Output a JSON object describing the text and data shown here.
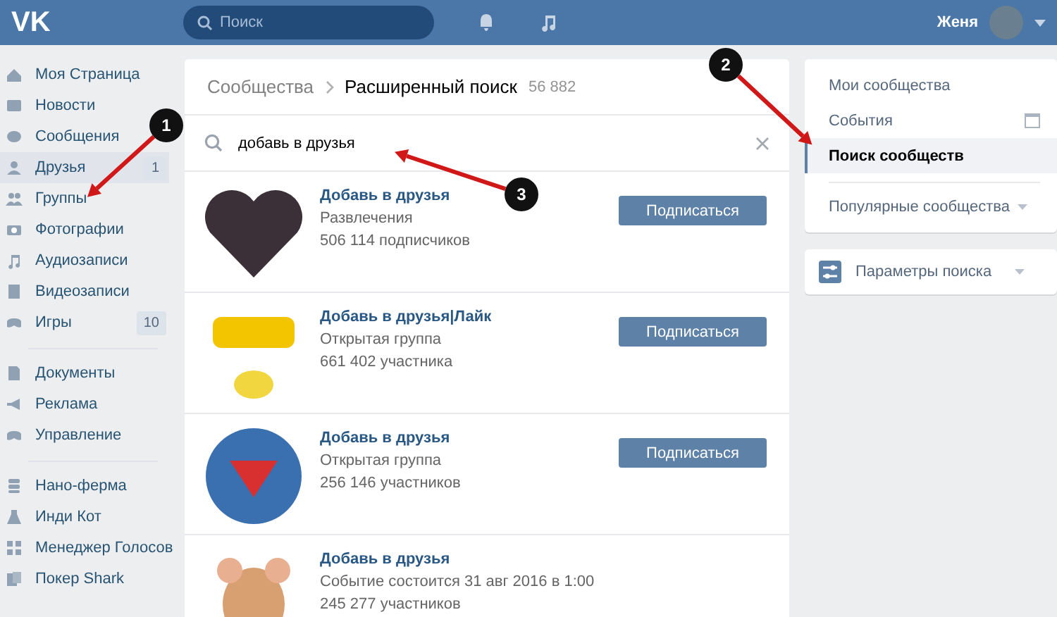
{
  "header": {
    "logo": "VK",
    "search": {
      "placeholder": "Поиск"
    },
    "user": {
      "name": "Женя"
    }
  },
  "sidebar": {
    "groups": [
      [
        {
          "label": "Моя Страница",
          "selected": false
        },
        {
          "label": "Новости",
          "selected": false
        },
        {
          "label": "Сообщения",
          "selected": false
        },
        {
          "label": "Друзья",
          "selected": true,
          "badge": "1"
        },
        {
          "label": "Группы",
          "selected": false
        },
        {
          "label": "Фотографии",
          "selected": false
        },
        {
          "label": "Аудиозаписи",
          "selected": false
        },
        {
          "label": "Видеозаписи",
          "selected": false
        },
        {
          "label": "Игры",
          "selected": false,
          "badge": "10"
        }
      ],
      [
        {
          "label": "Документы",
          "selected": false
        },
        {
          "label": "Реклама",
          "selected": false
        },
        {
          "label": "Управление",
          "selected": false
        }
      ],
      [
        {
          "label": "Нано-ферма",
          "selected": false
        },
        {
          "label": "Инди Кот",
          "selected": false
        },
        {
          "label": "Менеджер Голосов",
          "selected": false
        },
        {
          "label": "Покер Shark",
          "selected": false
        }
      ]
    ]
  },
  "content": {
    "breadcrumb": {
      "parent": "Сообщества",
      "current": "Расширенный поиск",
      "count": "56 882"
    },
    "search": {
      "value": "добавь в друзья"
    },
    "results": [
      {
        "title": "Добавь в друзья",
        "subtitle": "Развлечения",
        "count": "506 114 подписчиков",
        "button": "Подписаться"
      },
      {
        "title": "Добавь в друзья|Лайк",
        "subtitle": "Открытая группа",
        "count": "661 402 участника",
        "button": "Подписаться"
      },
      {
        "title": "Добавь в друзья",
        "subtitle": "Открытая группа",
        "count": "256 146 участников",
        "button": "Подписаться"
      },
      {
        "title": "Добавь в друзья",
        "subtitle": "Событие состоится 31 авг 2016 в 1:00",
        "count": "245 277 участников"
      }
    ]
  },
  "right": {
    "menu": [
      {
        "label": "Мои сообщества",
        "selected": false
      },
      {
        "label": "События",
        "selected": false
      },
      {
        "label": "Поиск сообществ",
        "selected": true
      },
      {
        "label": "Популярные сообщества",
        "selected": false
      }
    ],
    "filters": {
      "label": "Параметры поиска"
    }
  },
  "annotations": [
    {
      "label": "1"
    },
    {
      "label": "2"
    },
    {
      "label": "3"
    }
  ]
}
